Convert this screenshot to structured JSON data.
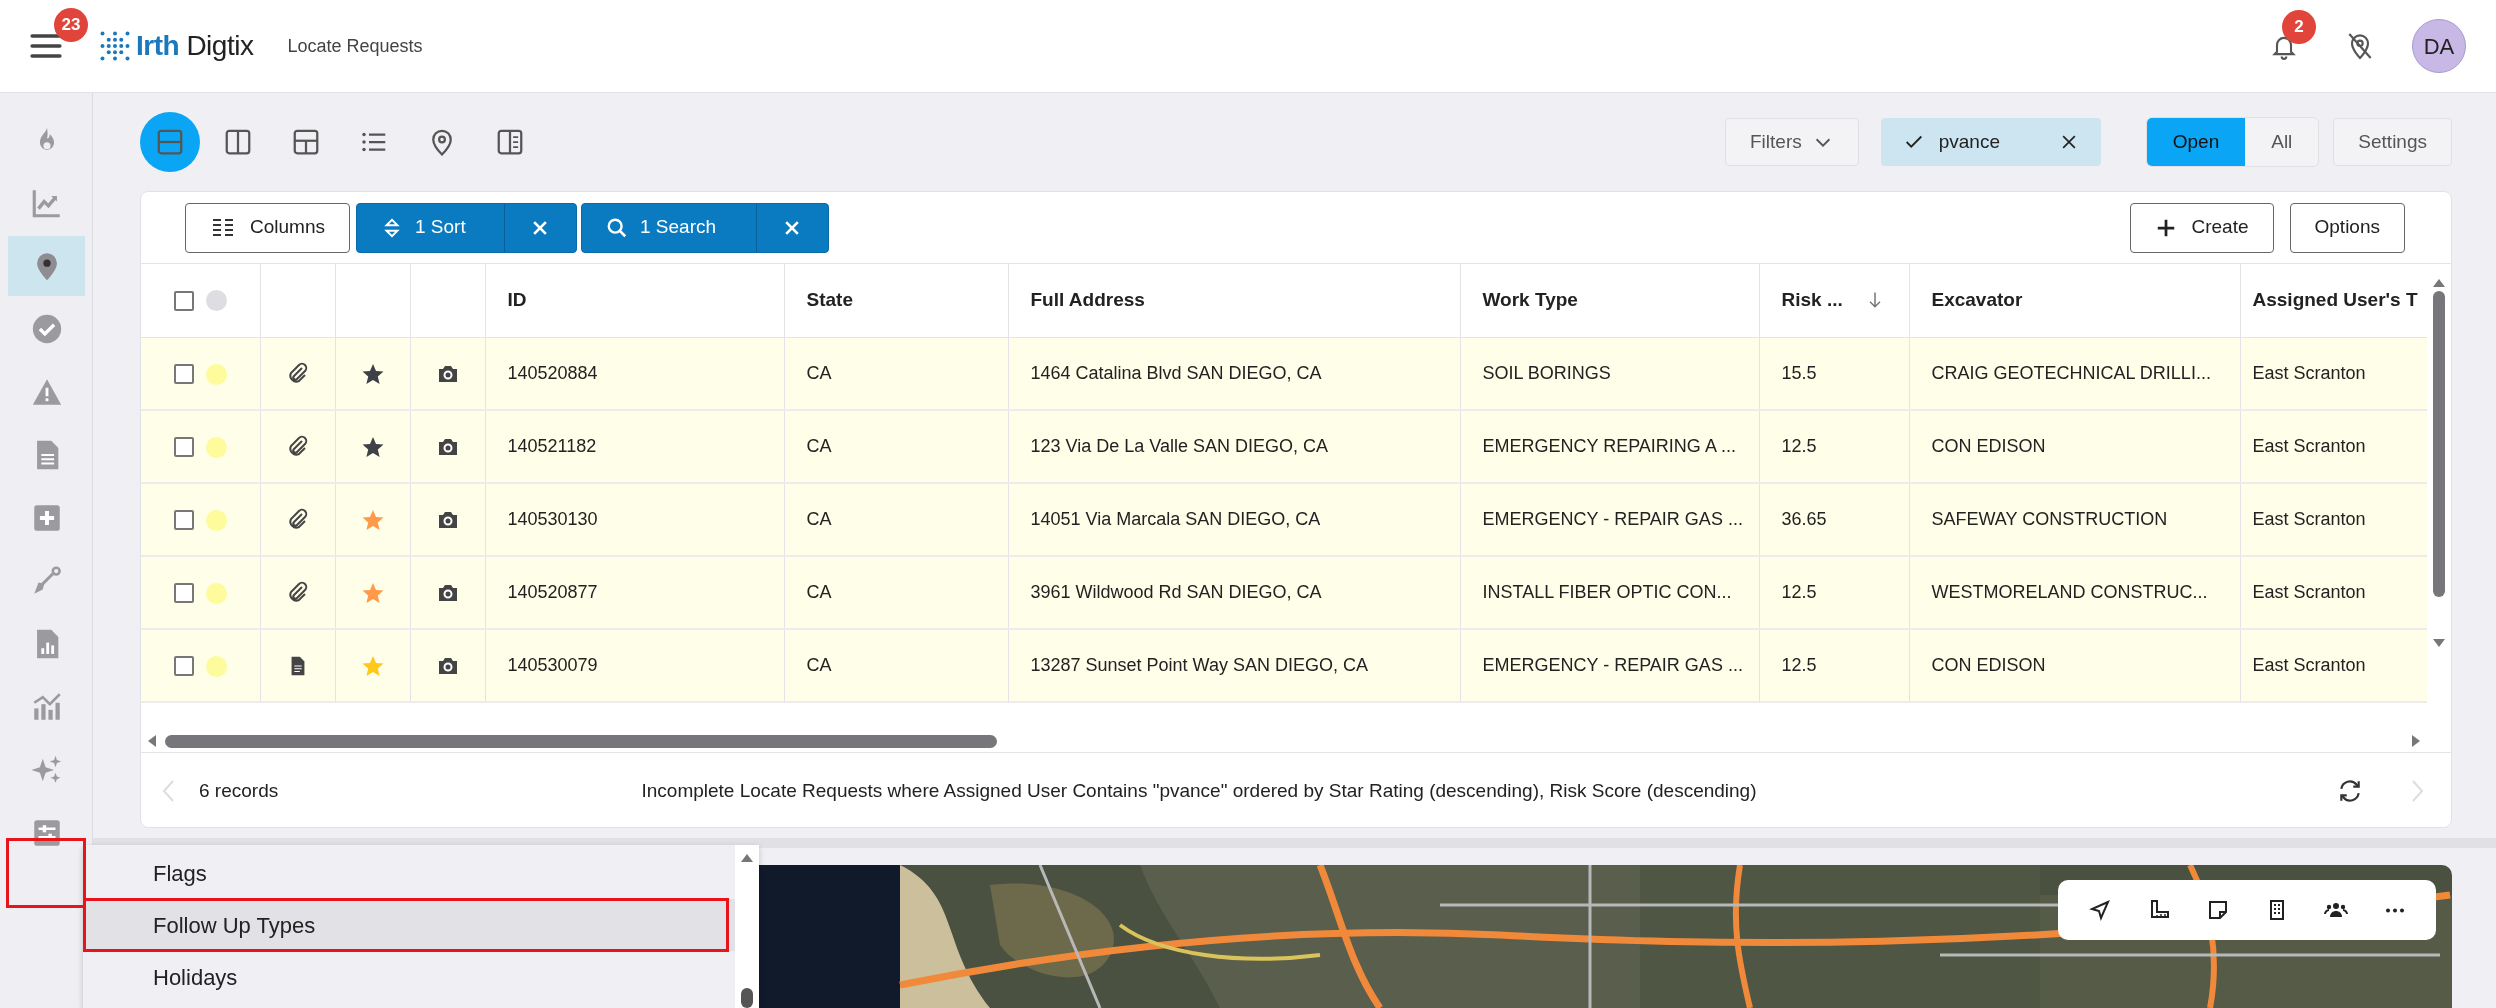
{
  "header": {
    "menu_badge": "23",
    "brand": "**Irth** Digtix",
    "page_title": "Locate Requests",
    "notification_badge": "2",
    "avatar": "DA"
  },
  "sidebar": {
    "items": [
      {
        "selected": false
      },
      {
        "selected": false
      },
      {
        "selected": true
      },
      {
        "selected": false
      },
      {
        "selected": false
      },
      {
        "selected": false
      },
      {
        "selected": false
      },
      {
        "selected": false
      },
      {
        "selected": false
      },
      {
        "selected": false
      },
      {
        "selected": false
      },
      {
        "selected": false
      }
    ]
  },
  "view_buttons": [
    {
      "selected": true
    },
    {
      "selected": false
    },
    {
      "selected": false
    },
    {
      "selected": false
    },
    {
      "selected": false
    },
    {
      "selected": false
    }
  ],
  "filters": {
    "filters_button": "Filters",
    "user_filter": {
      "label": "pvance",
      "checked": true
    },
    "scope": [
      {
        "label": "Open",
        "selected": true
      },
      {
        "label": "All",
        "selected": false
      }
    ],
    "settings_button": "Settings"
  },
  "grid_toolbar": {
    "columns_button": "Columns",
    "sort_chip": "1 Sort",
    "search_chip": "1 Search",
    "create_button": "Create",
    "options_button": "Options"
  },
  "table": {
    "select_all_checked": false,
    "columns": [
      {
        "label": "ID",
        "sorted": false
      },
      {
        "label": "State",
        "sorted": false
      },
      {
        "label": "Full Address",
        "sorted": false
      },
      {
        "label": "Work Type",
        "sorted": false
      },
      {
        "label": "Risk ...",
        "sorted": true
      },
      {
        "label": "Excavator",
        "sorted": false
      },
      {
        "label": "Assigned User's T",
        "sorted": false
      }
    ],
    "rows": [
      {
        "checked": false,
        "document_attachment": false,
        "color": "#3f4148",
        "cells": [
          "140520884",
          "CA",
          "1464 Catalina Blvd SAN DIEGO, CA",
          "SOIL BORINGS",
          "15.5",
          "CRAIG GEOTECHNICAL DRILLI...",
          "East Scranton"
        ]
      },
      {
        "checked": false,
        "document_attachment": false,
        "color": "#3f4148",
        "cells": [
          "140521182",
          "CA",
          "123 Via De La Valle SAN DIEGO, CA",
          "EMERGENCY REPAIRING A ...",
          "12.5",
          "CON EDISON",
          "East Scranton"
        ]
      },
      {
        "checked": false,
        "document_attachment": false,
        "color": "#ff9a4a",
        "cells": [
          "140530130",
          "CA",
          "14051 Via Marcala SAN DIEGO, CA",
          "EMERGENCY - REPAIR GAS ...",
          "36.65",
          "SAFEWAY CONSTRUCTION",
          "East Scranton"
        ]
      },
      {
        "checked": false,
        "document_attachment": false,
        "color": "#ff9a4a",
        "cells": [
          "140520877",
          "CA",
          "3961 Wildwood Rd SAN DIEGO, CA",
          "INSTALL FIBER OPTIC CON...",
          "12.5",
          "WESTMORELAND CONSTRUC...",
          "East Scranton"
        ]
      },
      {
        "checked": false,
        "document_attachment": true,
        "color": "#ffc81a",
        "cells": [
          "140530079",
          "CA",
          "13287 Sunset Point Way SAN DIEGO, CA",
          "EMERGENCY - REPAIR GAS ...",
          "12.5",
          "CON EDISON",
          "East Scranton"
        ]
      }
    ]
  },
  "footer": {
    "record_count": "6 records",
    "summary": "Incomplete Locate Requests where Assigned User Contains \"pvance\" ordered by Star Rating (descending), Risk Score (descending)"
  },
  "menu": {
    "items": [
      {
        "label": "Flags",
        "selected": false
      },
      {
        "label": "Follow Up Types",
        "selected": true
      },
      {
        "label": "Holidays",
        "selected": false
      }
    ]
  }
}
